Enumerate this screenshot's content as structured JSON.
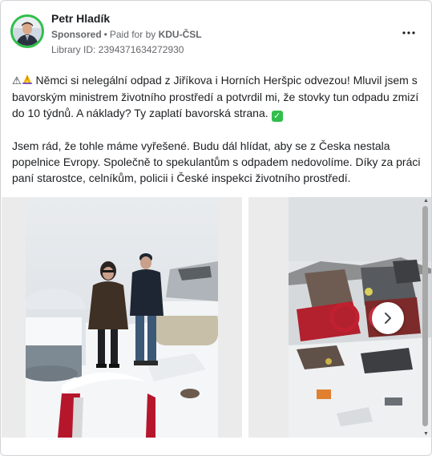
{
  "post": {
    "author": "Petr Hladík",
    "sponsored": "Sponsored",
    "paid_prefix": "Paid for by",
    "paid_by": "KDU-ČSL",
    "library_id": "Library ID: 2394371634272930",
    "paragraph1": "Němci si nelegální odpad z Jiříkova i Horních Heršpic odvezou! Mluvil jsem s bavorským ministrem životního prostředí a potvrdil mi, že stovky tun odpadu zmizí do 10 týdnů. A náklady? Ty zaplatí bavorská strana.",
    "paragraph2": "Jsem rád, že tohle máme vyřešené. Budu dál hlídat, aby se z Česka nestala popelnice Evropy. Společně to spekulantům s odpadem nedovolíme. Díky za práci paní starostce, celníkům, policii i České inspekci životního prostředí.",
    "icons": {
      "warning": "warning-icon",
      "pray": "pray-icon",
      "check": "check-icon",
      "more": "more-icon",
      "next": "chevron-right-icon"
    }
  },
  "colors": {
    "avatar_ring": "#2fbf4a",
    "meta_text": "#65676b",
    "text": "#1c1e21"
  }
}
